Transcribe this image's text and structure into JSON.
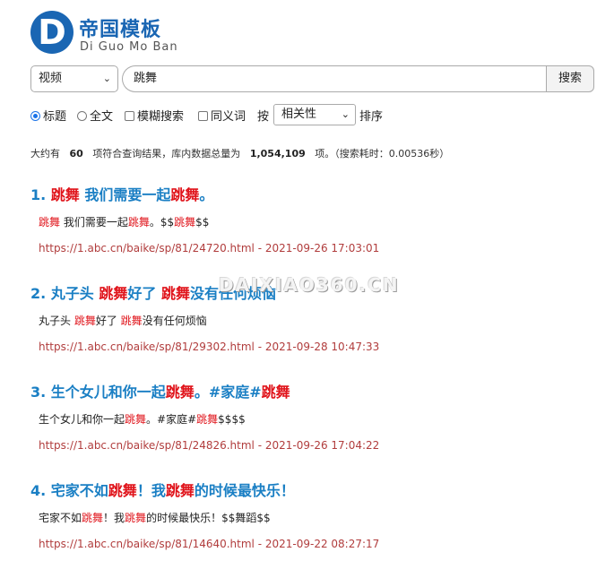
{
  "logo": {
    "letter": "D",
    "name_cn": "帝国模板",
    "name_en": "Di Guo Mo Ban"
  },
  "search": {
    "category": "视频",
    "keyword": "跳舞",
    "button": "搜索"
  },
  "options": {
    "field_title": "标题",
    "field_fulltext": "全文",
    "fuzzy": "模糊搜索",
    "synonym": "同义词",
    "by": "按",
    "sort_value": "相关性",
    "sort_suffix": "排序",
    "selected_field": "标题"
  },
  "stats": {
    "prefix": "大约有",
    "count": "60",
    "middle": "项符合查询结果，库内数据总量为",
    "total": "1,054,109",
    "suffix": "项。（搜索耗时：0.00536秒）"
  },
  "results": [
    {
      "title": [
        {
          "t": "1. "
        },
        {
          "t": "跳舞",
          "h": true
        },
        {
          "t": " 我们需要一起"
        },
        {
          "t": "跳舞",
          "h": true
        },
        {
          "t": "。"
        }
      ],
      "snippet": [
        {
          "t": "跳舞",
          "h": true
        },
        {
          "t": " 我们需要一起"
        },
        {
          "t": "跳舞",
          "h": true
        },
        {
          "t": "。$$"
        },
        {
          "t": "跳舞",
          "h": true
        },
        {
          "t": "$$"
        }
      ],
      "url": "https://1.abc.cn/baike/sp/81/24720.html - 2021-09-26 17:03:01"
    },
    {
      "title": [
        {
          "t": "2. 丸子头 "
        },
        {
          "t": "跳舞",
          "h": true
        },
        {
          "t": "好了 "
        },
        {
          "t": "跳舞",
          "h": true
        },
        {
          "t": "没有任何烦恼"
        }
      ],
      "snippet": [
        {
          "t": "丸子头 "
        },
        {
          "t": "跳舞",
          "h": true
        },
        {
          "t": "好了 "
        },
        {
          "t": "跳舞",
          "h": true
        },
        {
          "t": "没有任何烦恼"
        }
      ],
      "url": "https://1.abc.cn/baike/sp/81/29302.html - 2021-09-28 10:47:33"
    },
    {
      "title": [
        {
          "t": "3. 生个女儿和你一起"
        },
        {
          "t": "跳舞",
          "h": true
        },
        {
          "t": "。#家庭#"
        },
        {
          "t": "跳舞",
          "h": true
        }
      ],
      "snippet": [
        {
          "t": "生个女儿和你一起"
        },
        {
          "t": "跳舞",
          "h": true
        },
        {
          "t": "。#家庭#"
        },
        {
          "t": "跳舞",
          "h": true
        },
        {
          "t": "$$$$"
        }
      ],
      "url": "https://1.abc.cn/baike/sp/81/24826.html - 2021-09-26 17:04:22"
    },
    {
      "title": [
        {
          "t": "4. 宅家不如"
        },
        {
          "t": "跳舞",
          "h": true
        },
        {
          "t": "！我"
        },
        {
          "t": "跳舞",
          "h": true
        },
        {
          "t": "的时候最快乐！"
        }
      ],
      "snippet": [
        {
          "t": "宅家不如"
        },
        {
          "t": "跳舞",
          "h": true
        },
        {
          "t": "！我"
        },
        {
          "t": "跳舞",
          "h": true
        },
        {
          "t": "的时候最快乐！$$舞蹈$$"
        }
      ],
      "url": "https://1.abc.cn/baike/sp/81/14640.html - 2021-09-22 08:27:17"
    }
  ],
  "watermark": "DAIXIAO360.CN",
  "colors": {
    "brand": "#1a66b3",
    "title": "#1a7fc4",
    "highlight": "#e0141b",
    "url": "#b13d3d"
  }
}
